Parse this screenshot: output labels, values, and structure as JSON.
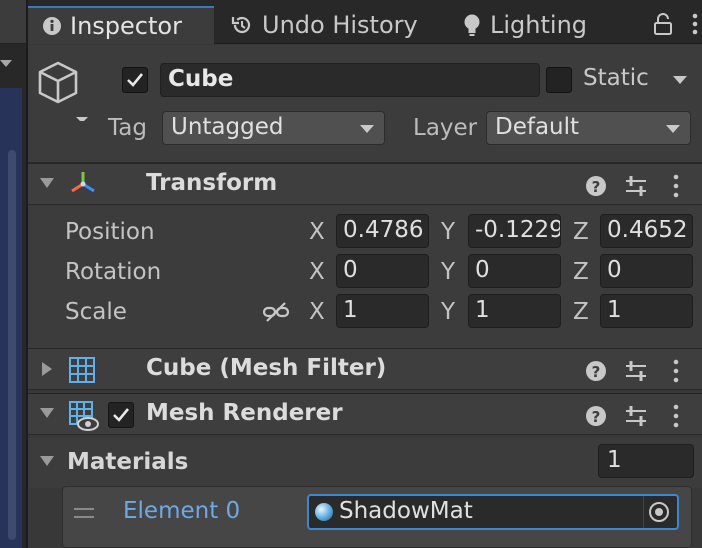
{
  "tabs": {
    "inspector": "Inspector",
    "undo_history": "Undo History",
    "lighting": "Lighting"
  },
  "header": {
    "enabled": true,
    "object_name": "Cube",
    "static_label": "Static",
    "static_checked": false,
    "tag_label": "Tag",
    "tag_value": "Untagged",
    "layer_label": "Layer",
    "layer_value": "Default"
  },
  "transform": {
    "title": "Transform",
    "rows": [
      {
        "label": "Position",
        "x": "0.4786",
        "y": "-0.1229",
        "z": "0.4652"
      },
      {
        "label": "Rotation",
        "x": "0",
        "y": "0",
        "z": "0"
      },
      {
        "label": "Scale",
        "x": "1",
        "y": "1",
        "z": "1"
      }
    ],
    "axis_labels": {
      "x": "X",
      "y": "Y",
      "z": "Z"
    }
  },
  "mesh_filter": {
    "title": "Cube (Mesh Filter)"
  },
  "mesh_renderer": {
    "title": "Mesh Renderer",
    "enabled": true,
    "materials_label": "Materials",
    "materials_count": "1",
    "element_label": "Element 0",
    "element_value": "ShadowMat"
  },
  "colors": {
    "accent": "#3a79bb",
    "element_label": "#6ea9e6",
    "background": "#383838"
  }
}
